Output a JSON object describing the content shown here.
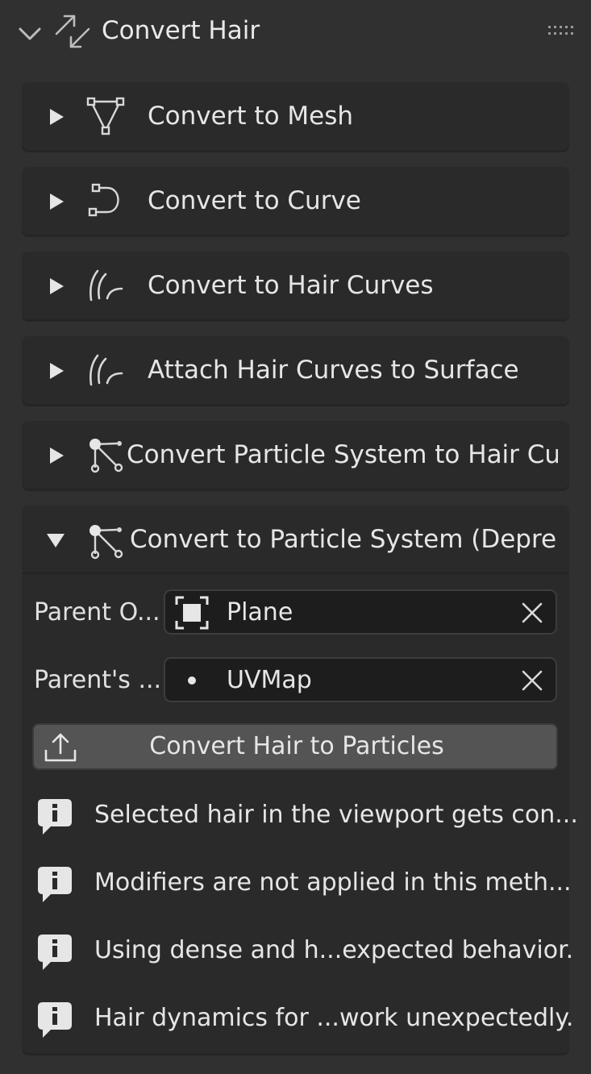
{
  "panel": {
    "title": "Convert Hair",
    "icons": {
      "collapse": "chevron-down-icon",
      "header": "convert-arrows-icon",
      "grip": "drag-grip-icon"
    }
  },
  "subpanels": [
    {
      "label": "Convert to Mesh",
      "icon": "mesh-icon",
      "expanded": false
    },
    {
      "label": "Convert to Curve",
      "icon": "curve-icon",
      "expanded": false
    },
    {
      "label": "Convert to Hair Curves",
      "icon": "hair-curves-icon",
      "expanded": false
    },
    {
      "label": "Attach Hair Curves to Surface",
      "icon": "hair-curves-icon",
      "expanded": false
    },
    {
      "label": "Convert Particle System to Hair Cu...",
      "icon": "particles-icon",
      "expanded": false
    }
  ],
  "expanded_panel": {
    "label": "Convert to Particle System (Depre...",
    "icon": "particles-icon",
    "expanded": true,
    "parent_object": {
      "label": "Parent O...",
      "value": "Plane",
      "icon": "object-icon"
    },
    "parent_uv": {
      "label": "Parent's ...",
      "value": "UVMap",
      "icon": "dot-icon"
    },
    "button": {
      "label": "Convert Hair to Particles",
      "icon": "export-icon"
    },
    "info": [
      "Selected hair in the viewport gets con...",
      "Modifiers are not applied in this meth...",
      "Using dense and h...expected behavior.",
      "Hair dynamics for ...work unexpectedly."
    ]
  },
  "colors": {
    "background": "#303030",
    "subpanel": "#2a2a2a",
    "field": "#1d1d1d",
    "button": "#545454",
    "text": "#e6e6e6"
  }
}
